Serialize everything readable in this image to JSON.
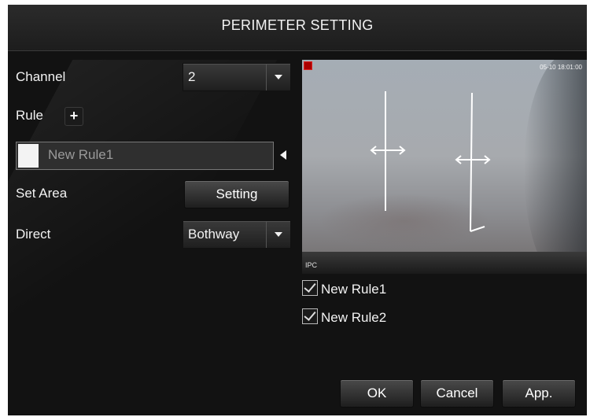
{
  "dialog": {
    "title": "PERIMETER SETTING"
  },
  "form": {
    "channel_label": "Channel",
    "channel_value": "2",
    "rule_label": "Rule",
    "add_rule_symbol": "+",
    "rule_name_value": "New Rule1",
    "set_area_label": "Set Area",
    "setting_button_label": "Setting",
    "direct_label": "Direct",
    "direct_value": "Bothway"
  },
  "preview": {
    "timestamp": "05-10 18:01:00",
    "camera_label": "IPC"
  },
  "rules_list": [
    {
      "label": "New Rule1",
      "checked": true
    },
    {
      "label": "New Rule2",
      "checked": true
    }
  ],
  "footer": {
    "ok_label": "OK",
    "cancel_label": "Cancel",
    "apply_label": "App."
  },
  "colors": {
    "background": "#121212",
    "text": "#f2f2f2",
    "rule_line": "#ffffff"
  },
  "icons": [
    "add-icon",
    "dropdown-arrow-icon",
    "collapse-arrow-icon",
    "checkbox-icon",
    "record-indicator-icon"
  ]
}
